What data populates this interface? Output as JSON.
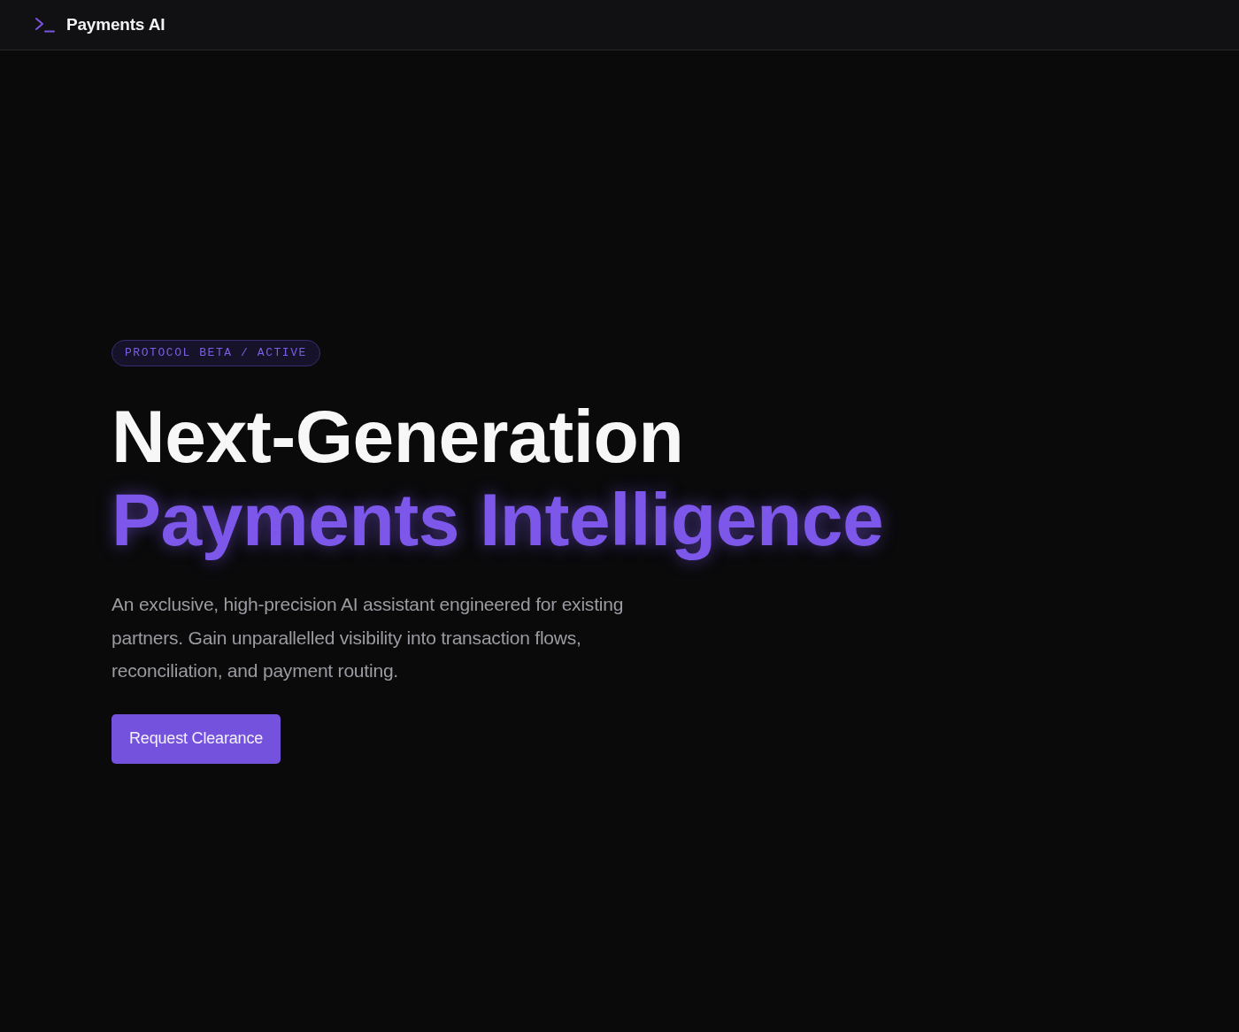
{
  "header": {
    "brand": "Payments AI"
  },
  "hero": {
    "badge": "PROTOCOL BETA / ACTIVE",
    "headline": {
      "line_1": "Next-Generation",
      "line_2": "Payments Intelligence"
    },
    "description": "An exclusive, high-precision AI assistant engineered for existing partners. Gain unparallelled visibility into transaction flows, reconciliation, and payment routing.",
    "button": "Request Clearance"
  }
}
